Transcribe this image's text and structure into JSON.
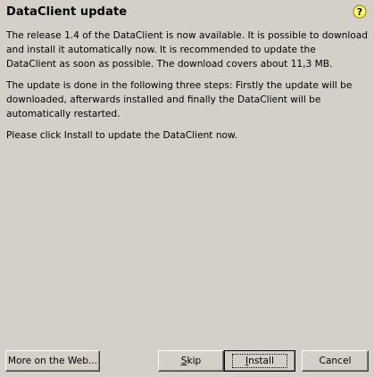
{
  "dialog": {
    "title": "DataClient update",
    "help_icon": "question-help-icon",
    "paragraphs": [
      "The release 1.4 of the DataClient is now available. It is possible to download and install it automatically now. It is recommended to update the DataClient as soon as possible. The download covers about 11,3 MB.",
      "The update is done in the following three steps: Firstly the update will be downloaded, afterwards installed and finally the DataClient will be automatically restarted.",
      "Please click Install to update the DataClient now."
    ]
  },
  "buttons": {
    "more_on_web": "More on the Web...",
    "skip_first": "S",
    "skip_rest": "kip",
    "install_first": "I",
    "install_rest": "nstall",
    "cancel": "Cancel"
  },
  "colors": {
    "background": "#d4d0c8",
    "help_icon_fill": "#ffff66"
  }
}
